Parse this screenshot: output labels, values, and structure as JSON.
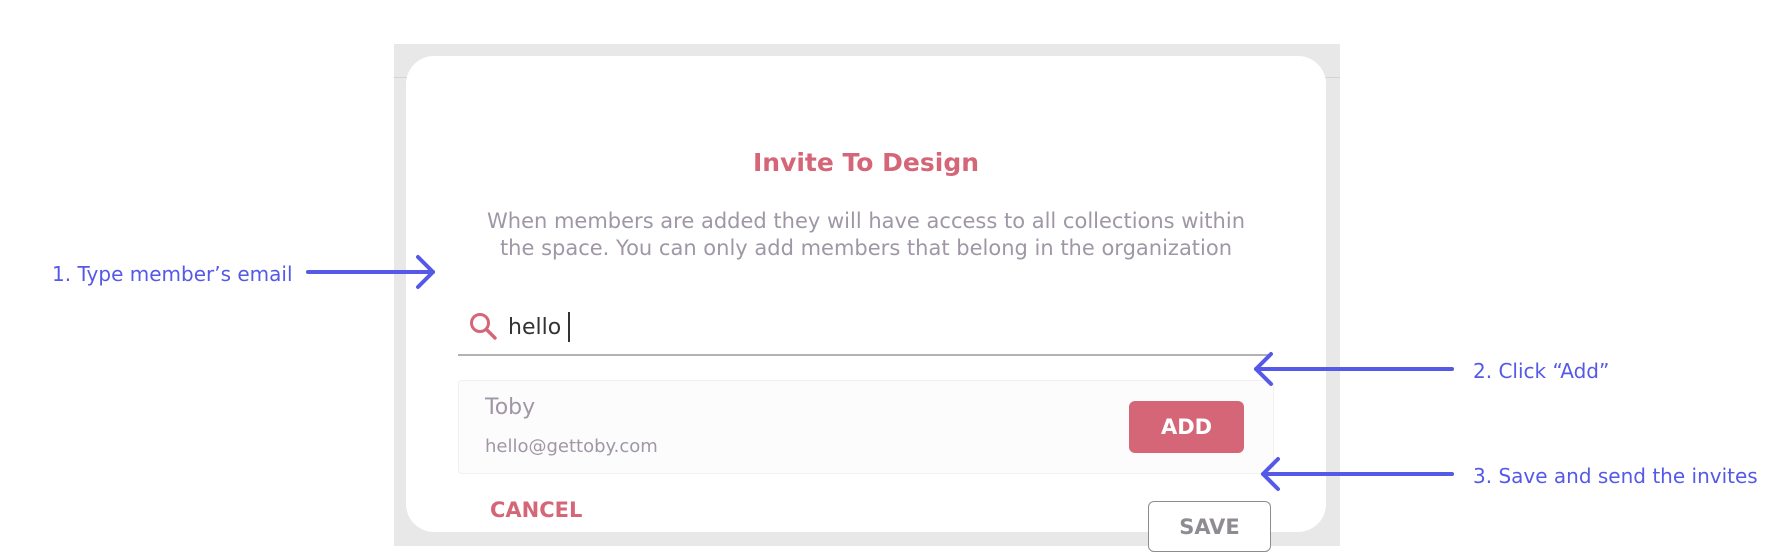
{
  "dialog": {
    "title": "Invite To Design",
    "description": "When members are added they will have access to all collections within the space. You can only add members that belong in the organization",
    "search": {
      "value": "hello",
      "icon": "search-icon"
    },
    "result": {
      "name": "Toby",
      "email": "hello@gettoby.com",
      "add_label": "ADD"
    },
    "cancel_label": "CANCEL",
    "save_label": "SAVE"
  },
  "callouts": {
    "step1": "1. Type member’s email",
    "step2": "2. Click “Add”",
    "step3": "3. Save and send the invites"
  },
  "colors": {
    "accent": "#d46678",
    "muted_text": "#9f97a6",
    "callout": "#5559e8",
    "backdrop": "#e8e8e8"
  }
}
